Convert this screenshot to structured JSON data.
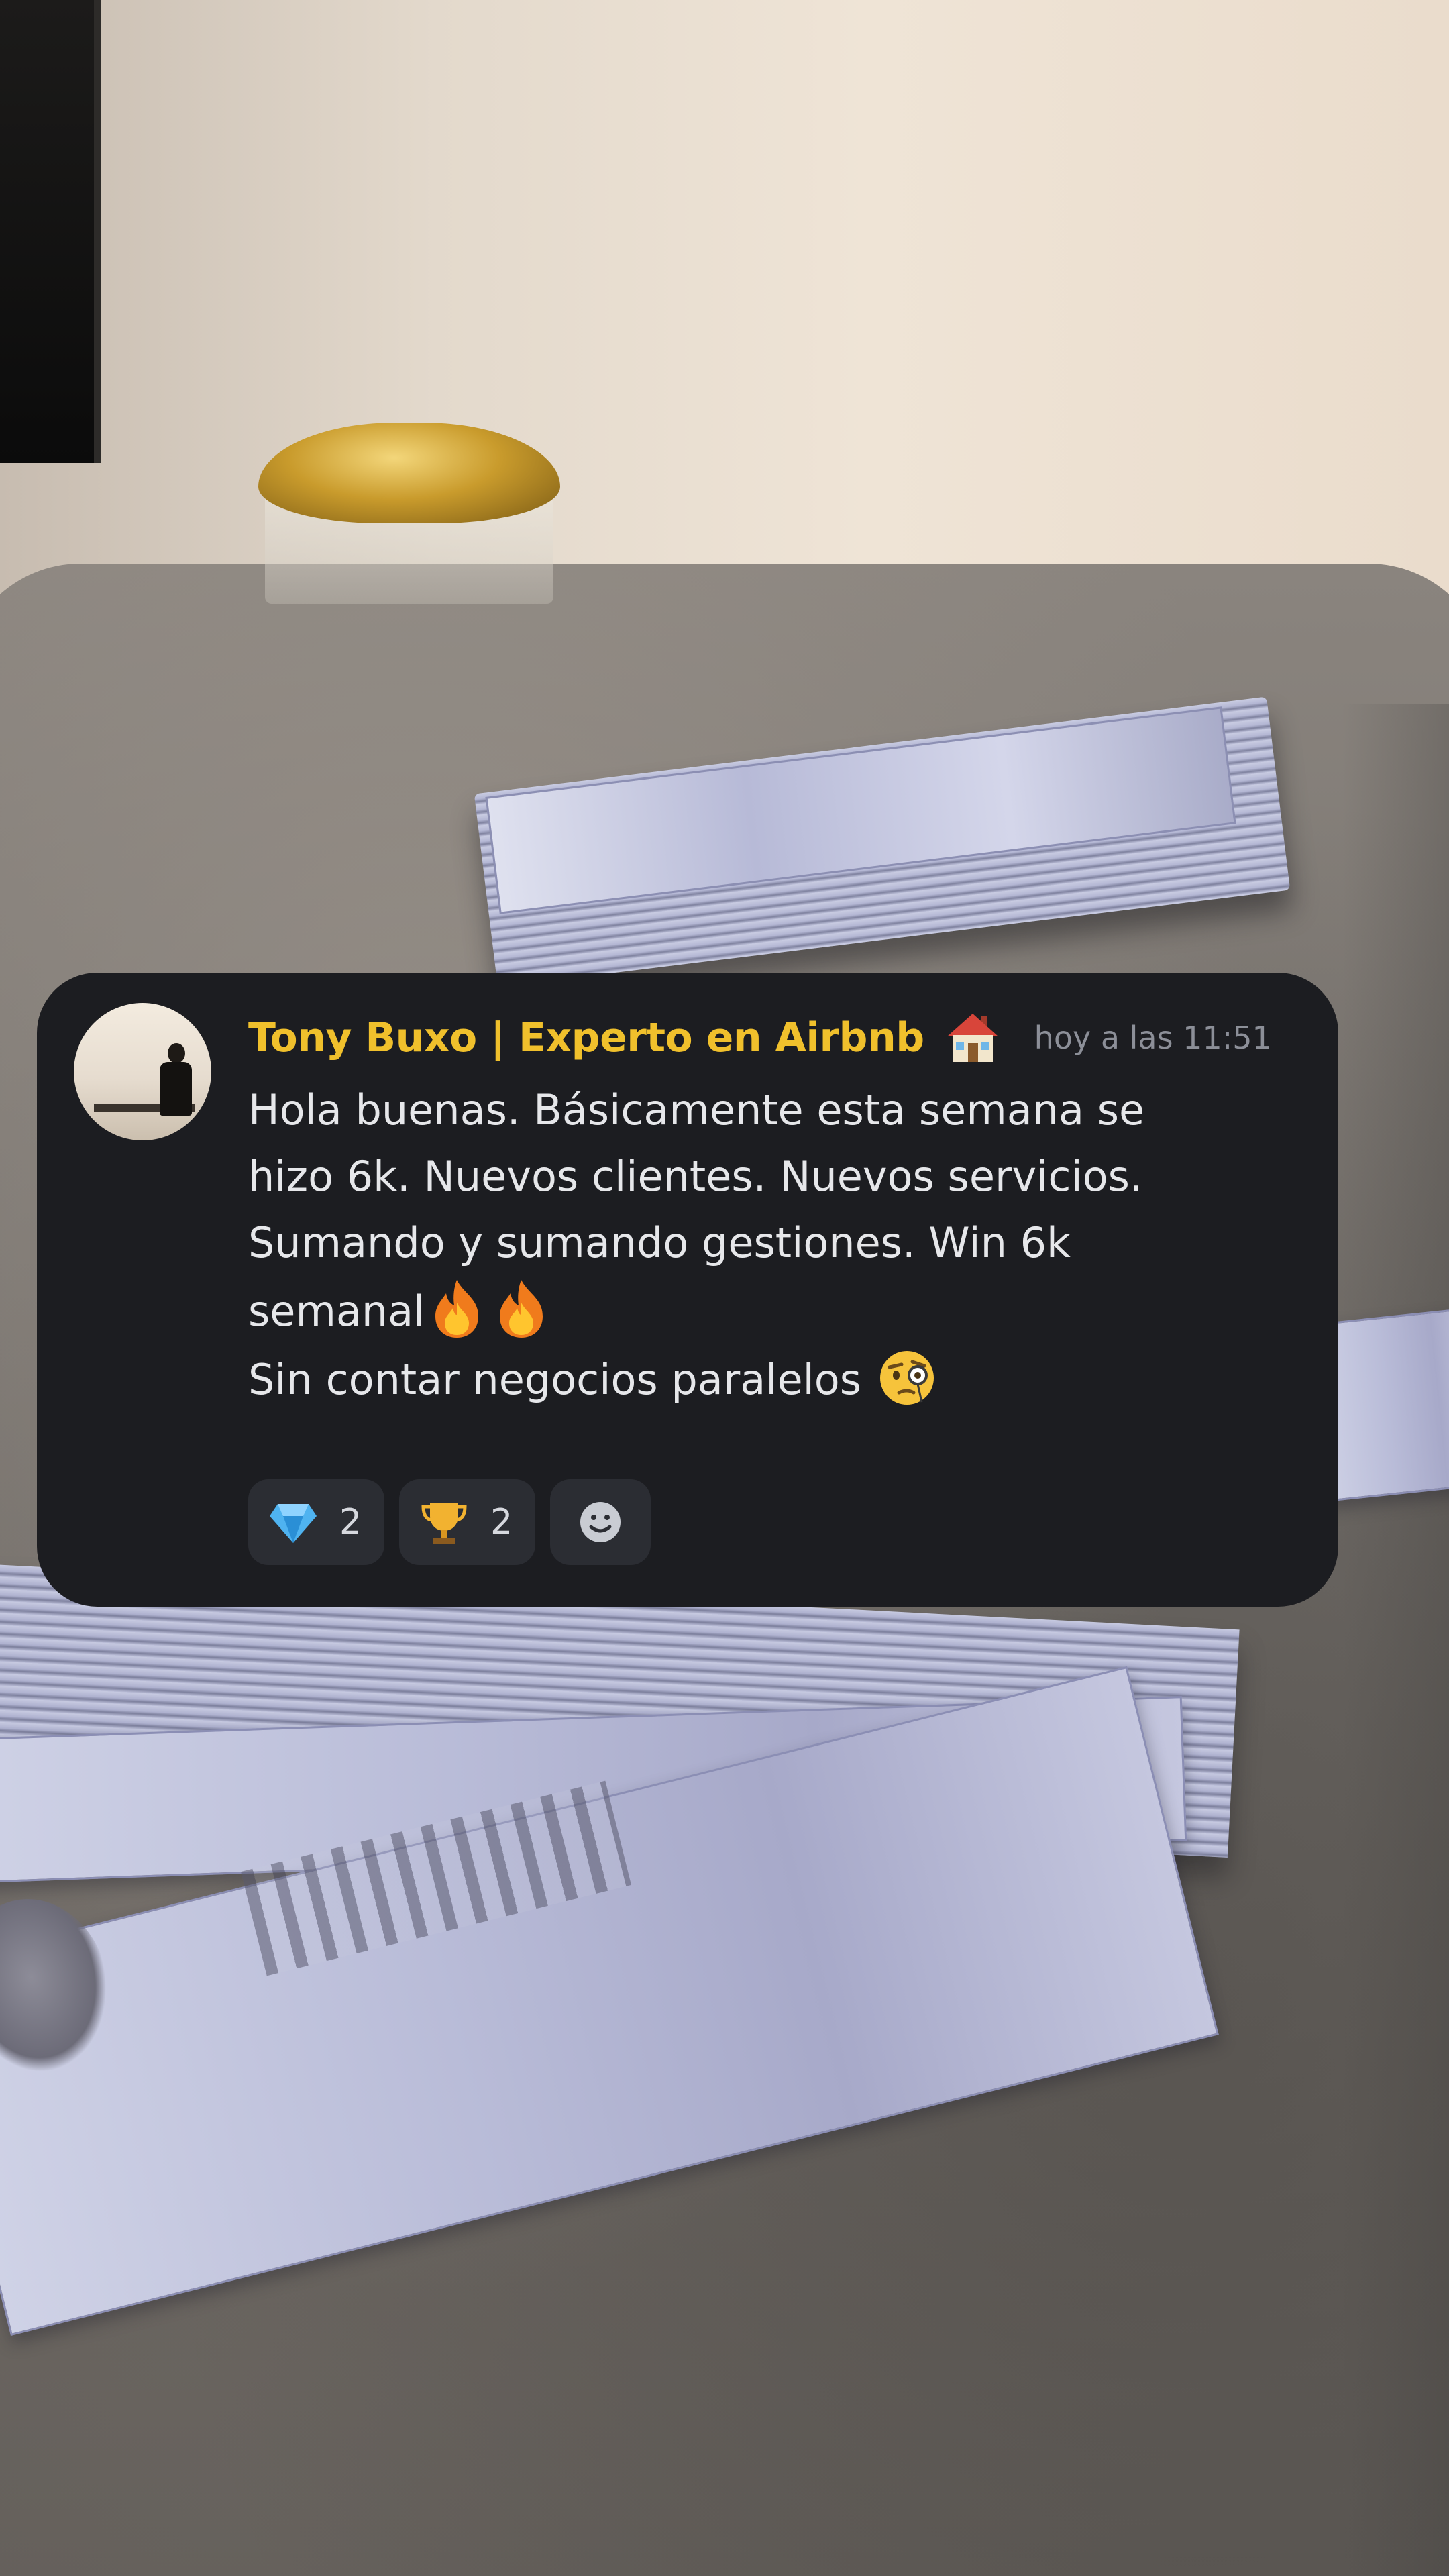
{
  "message": {
    "author": "Tony Buxo | Experto en Airbnb",
    "author_badge_icon": "house-emoji",
    "timestamp": "hoy a las 11:51",
    "lines": [
      "Hola buenas. Básicamente esta semana se",
      "hizo 6k. Nuevos clientes. Nuevos servicios.",
      "Sumando y sumando gestiones. Win 6k",
      "semanal",
      "Sin contar negocios paralelos"
    ],
    "inline_emojis": {
      "semanal": [
        "fire-emoji",
        "fire-emoji"
      ],
      "paralelos": [
        "face-with-monocle-emoji"
      ]
    }
  },
  "reactions": [
    {
      "icon": "gem-emoji",
      "count": "2"
    },
    {
      "icon": "trophy-emoji",
      "count": "2"
    }
  ],
  "add_reaction_icon": "smiley-add-reaction-icon",
  "colors": {
    "card_bg": "#1c1d21",
    "author": "#f0c02c",
    "timestamp": "#8c8f98",
    "text": "#e6e7ea",
    "reaction_bg": "#2b2d33"
  }
}
